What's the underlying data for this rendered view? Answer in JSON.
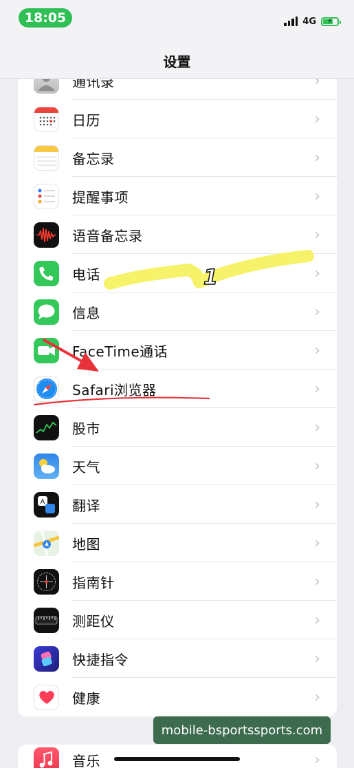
{
  "status": {
    "time": "18:05",
    "network": "4G"
  },
  "nav": {
    "title": "设置"
  },
  "items": [
    {
      "label": "通讯录",
      "icon": "contacts-icon"
    },
    {
      "label": "日历",
      "icon": "calendar-icon"
    },
    {
      "label": "备忘录",
      "icon": "notes-icon"
    },
    {
      "label": "提醒事项",
      "icon": "reminders-icon"
    },
    {
      "label": "语音备忘录",
      "icon": "voice-memos-icon"
    },
    {
      "label": "电话",
      "icon": "phone-icon"
    },
    {
      "label": "信息",
      "icon": "messages-icon"
    },
    {
      "label": "FaceTime通话",
      "icon": "facetime-icon"
    },
    {
      "label": "Safari浏览器",
      "icon": "safari-icon"
    },
    {
      "label": "股市",
      "icon": "stocks-icon"
    },
    {
      "label": "天气",
      "icon": "weather-icon"
    },
    {
      "label": "翻译",
      "icon": "translate-icon"
    },
    {
      "label": "地图",
      "icon": "maps-icon"
    },
    {
      "label": "指南针",
      "icon": "compass-icon"
    },
    {
      "label": "测距仪",
      "icon": "measure-icon"
    },
    {
      "label": "快捷指令",
      "icon": "shortcuts-icon"
    },
    {
      "label": "健康",
      "icon": "health-icon"
    }
  ],
  "next_group": [
    {
      "label": "音乐",
      "icon": "music-icon"
    }
  ],
  "annotation": {
    "step_number": "1"
  },
  "watermark": "mobile-bsportssports.com",
  "colors": {
    "status_pill": "#2fbf55",
    "highlight": "#f5f25a",
    "annotation_red": "#e8323a"
  }
}
